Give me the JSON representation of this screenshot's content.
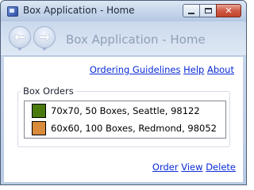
{
  "window": {
    "title": "Box Application - Home",
    "caption_buttons": {
      "minimize_icon": "minimize-icon",
      "maximize_icon": "maximize-icon",
      "close_label": "✕"
    }
  },
  "navigation": {
    "back_glyph": "←",
    "forward_glyph": "→",
    "page_title": "Box Application - Home"
  },
  "top_links": [
    {
      "label": "Ordering Guidelines"
    },
    {
      "label": "Help"
    },
    {
      "label": "About"
    }
  ],
  "box_orders": {
    "group_label": "Box Orders",
    "items": [
      {
        "text": "70x70, 50 Boxes, Seattle, 98122",
        "color": "#4a7a0e"
      },
      {
        "text": "60x60, 100 Boxes, Redmond, 98052",
        "color": "#d98a3a"
      }
    ]
  },
  "bottom_links": [
    {
      "label": "Order"
    },
    {
      "label": "View"
    },
    {
      "label": "Delete"
    }
  ],
  "colors": {
    "link": "#0b2bd6",
    "close_button": "#c3432d",
    "chrome": "#c7d6eb"
  }
}
